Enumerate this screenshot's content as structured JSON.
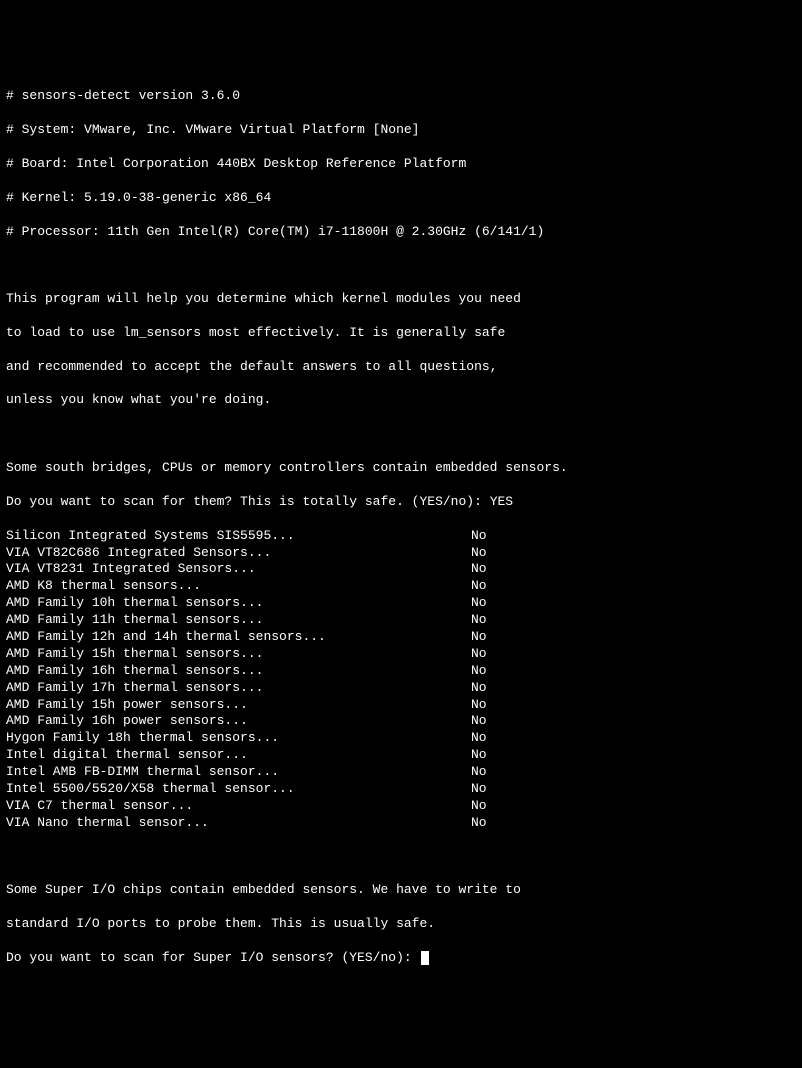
{
  "header": {
    "version": "# sensors-detect version 3.6.0",
    "system": "# System: VMware, Inc. VMware Virtual Platform [None]",
    "board": "# Board: Intel Corporation 440BX Desktop Reference Platform",
    "kernel": "# Kernel: 5.19.0-38-generic x86_64",
    "processor": "# Processor: 11th Gen Intel(R) Core(TM) i7-11800H @ 2.30GHz (6/141/1)"
  },
  "intro": {
    "line1": "This program will help you determine which kernel modules you need",
    "line2": "to load to use lm_sensors most effectively. It is generally safe",
    "line3": "and recommended to accept the default answers to all questions,",
    "line4": "unless you know what you're doing."
  },
  "section1": {
    "desc": "Some south bridges, CPUs or memory controllers contain embedded sensors.",
    "prompt": "Do you want to scan for them? This is totally safe. (YES/no): ",
    "answer": "YES"
  },
  "scans": [
    {
      "name": "Silicon Integrated Systems SIS5595...",
      "result": "No"
    },
    {
      "name": "VIA VT82C686 Integrated Sensors...",
      "result": "No"
    },
    {
      "name": "VIA VT8231 Integrated Sensors...",
      "result": "No"
    },
    {
      "name": "AMD K8 thermal sensors...",
      "result": "No"
    },
    {
      "name": "AMD Family 10h thermal sensors...",
      "result": "No"
    },
    {
      "name": "AMD Family 11h thermal sensors...",
      "result": "No"
    },
    {
      "name": "AMD Family 12h and 14h thermal sensors...",
      "result": "No"
    },
    {
      "name": "AMD Family 15h thermal sensors...",
      "result": "No"
    },
    {
      "name": "AMD Family 16h thermal sensors...",
      "result": "No"
    },
    {
      "name": "AMD Family 17h thermal sensors...",
      "result": "No"
    },
    {
      "name": "AMD Family 15h power sensors...",
      "result": "No"
    },
    {
      "name": "AMD Family 16h power sensors...",
      "result": "No"
    },
    {
      "name": "Hygon Family 18h thermal sensors...",
      "result": "No"
    },
    {
      "name": "Intel digital thermal sensor...",
      "result": "No"
    },
    {
      "name": "Intel AMB FB-DIMM thermal sensor...",
      "result": "No"
    },
    {
      "name": "Intel 5500/5520/X58 thermal sensor...",
      "result": "No"
    },
    {
      "name": "VIA C7 thermal sensor...",
      "result": "No"
    },
    {
      "name": "VIA Nano thermal sensor...",
      "result": "No"
    }
  ],
  "section2": {
    "desc1": "Some Super I/O chips contain embedded sensors. We have to write to",
    "desc2": "standard I/O ports to probe them. This is usually safe.",
    "prompt": "Do you want to scan for Super I/O sensors? (YES/no): "
  }
}
